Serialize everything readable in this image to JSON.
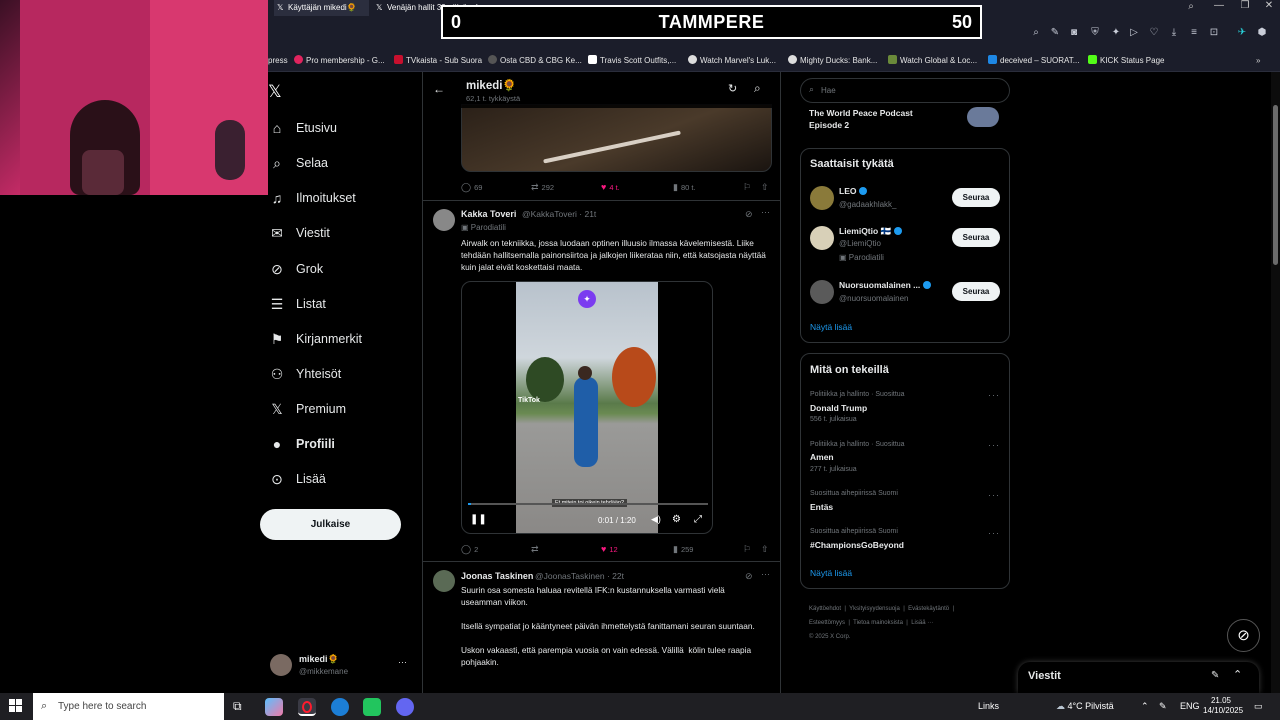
{
  "browser": {
    "tabs": [
      {
        "label": "Käyttäjän mikedi🌻",
        "active": true
      },
      {
        "label": "Venäjän hallit 30 päivässä",
        "active": false
      }
    ],
    "bookmarks": [
      "press",
      "Pro membership - G...",
      "TVkaista - Sub Suora",
      "Osta CBD & CBG Ke...",
      "Travis Scott Outfits,...",
      "Watch Marvel's Luk...",
      "Mighty Ducks: Bank...",
      "Watch Global & Loc...",
      "deceived – SUORAT...",
      "KICK Status Page"
    ]
  },
  "scoreboard": {
    "left_score": "0",
    "team": "TAMMPERE",
    "right_score": "50"
  },
  "nav": {
    "items": [
      "Etusivu",
      "Selaa",
      "Ilmoitukset",
      "Viestit",
      "Grok",
      "Listat",
      "Kirjanmerkit",
      "Yhteisöt",
      "Premium",
      "Profiili",
      "Lisää"
    ],
    "post_button": "Julkaise",
    "account_name": "mikedi🌻",
    "account_handle": "@mikkemane"
  },
  "header": {
    "title": "mikedi🌻",
    "subtitle": "62,1 t. tykkäystä"
  },
  "tweets": [
    {
      "actions": {
        "replies": "69",
        "retweets": "292",
        "likes": "4 t.",
        "views": "80 t."
      }
    },
    {
      "name": "Kakka Toveri",
      "handle": "@KakkaToveri · 21t",
      "label": "Parodiatili",
      "text": "Airwalk on tekniikka, jossa luodaan optinen illuusio ilmassa kävelemisestä. Liike tehdään hallitsemalla painonsiirtoa ja jalkojen liikerataa niin, että katsojasta näyttää kuin jalat eivät koskettaisi maata.",
      "video": {
        "time": "0:01 / 1:20",
        "caption": "Et mitein toi oikein tehdään?",
        "watermark": "TikTok"
      },
      "actions": {
        "replies": "2",
        "retweets": "",
        "likes": "12",
        "views": "259"
      }
    },
    {
      "name": "Joonas Taskinen",
      "handle": "@JoonasTaskinen · 22t",
      "text": "Suurin osa somesta haluaa revitellä IFK:n kustannuksella varmasti vielä useamman viikon.\n\nItsellä sympatiat jo kääntyneet päivän ihmettelystä fanittamani seuran suuntaan.\n\nUskon vakaasti, että parempia vuosia on vain edessä. Välillä  kölin tulee raapia pohjaakin."
    }
  ],
  "search": {
    "placeholder": "Hae"
  },
  "podcast": {
    "title": "The World Peace Podcast Episode 2"
  },
  "who_to_follow": {
    "title": "Saattaisit tykätä",
    "users": [
      {
        "name": "LEO",
        "handle": "@gadaakhlakk_",
        "label": ""
      },
      {
        "name": "LiemiQtio 🇫🇮",
        "handle": "@LiemiQtio",
        "label": "Parodiatili"
      },
      {
        "name": "Nuorsuomalainen ...",
        "handle": "@nuorsuomalainen",
        "label": ""
      }
    ],
    "follow_label": "Seuraa",
    "show_more": "Näytä lisää"
  },
  "trends": {
    "title": "Mitä on tekeillä",
    "items": [
      {
        "context": "Politiikka ja hallinto · Suosittua",
        "name": "Donald Trump",
        "count": "556 t. julkaisua"
      },
      {
        "context": "Politiikka ja hallinto · Suosittua",
        "name": "Amen",
        "count": "277 t. julkaisua"
      },
      {
        "context": "Suosittua aihepiirissä Suomi",
        "name": "Entäs",
        "count": ""
      },
      {
        "context": "Suosittua aihepiirissä Suomi",
        "name": "#ChampionsGoBeyond",
        "count": ""
      }
    ],
    "show_more": "Näytä lisää"
  },
  "footer": {
    "links": [
      "Käyttöehdot",
      "Yksityisyydensuoja",
      "Evästekäytäntö",
      "Esteettömyys",
      "Tietoa mainoksista",
      "Lisää ···"
    ],
    "copyright": "© 2025 X Corp."
  },
  "messages": {
    "title": "Viestit"
  },
  "taskbar": {
    "search_placeholder": "Type here to search",
    "links": "Links",
    "weather": "4°C  Pilvistä",
    "lang": "ENG",
    "time": "21.05",
    "date": "14/10/2025"
  },
  "colors": {
    "like": "#f91880",
    "link": "#1d9bf0",
    "bg": "#000000"
  }
}
